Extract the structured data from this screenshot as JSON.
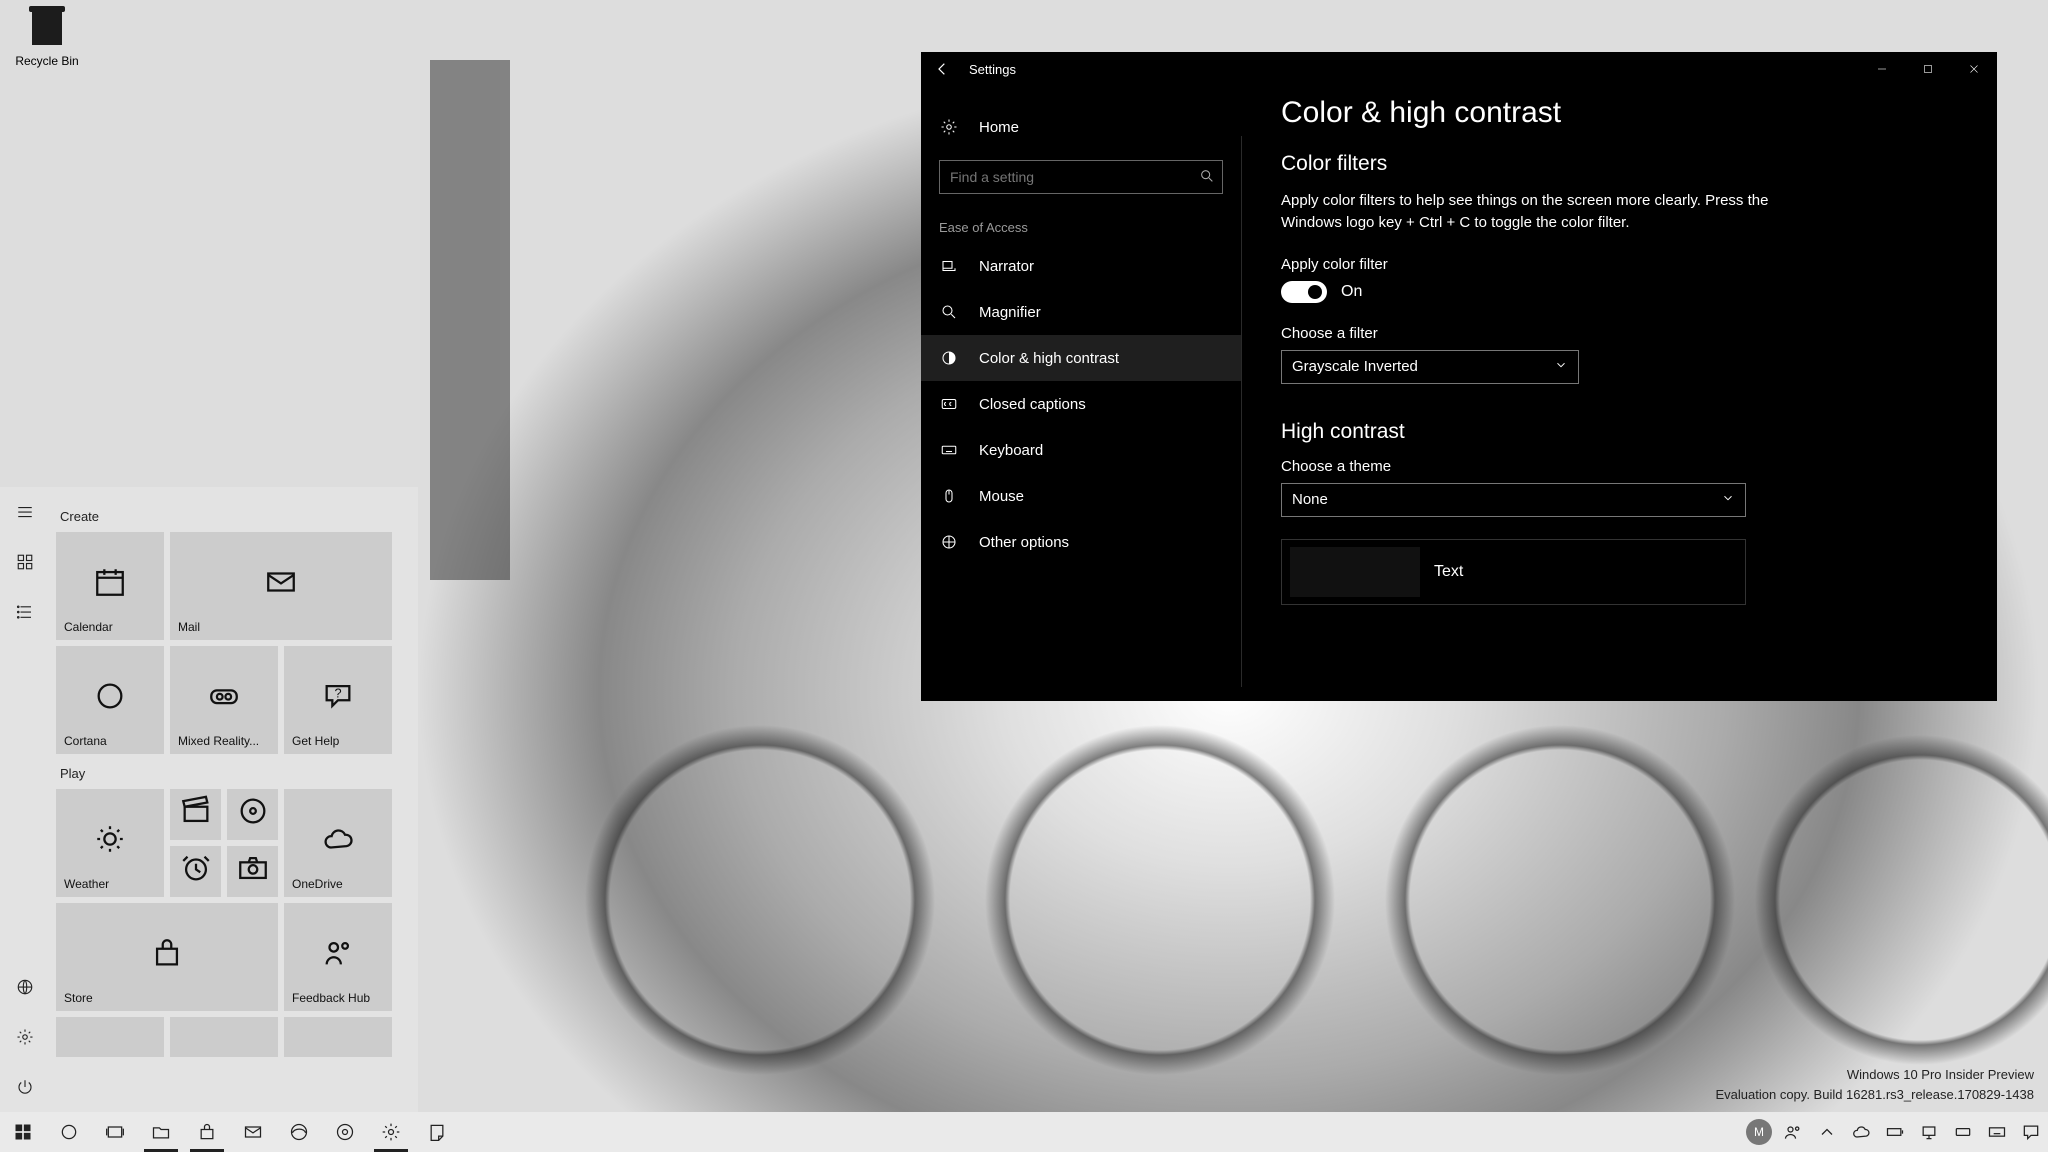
{
  "desktop": {
    "recycle_bin_label": "Recycle Bin"
  },
  "watermark": {
    "line1": "Windows 10 Pro Insider Preview",
    "line2": "Evaluation copy. Build 16281.rs3_release.170829-1438"
  },
  "start": {
    "groups": [
      {
        "label": "Create"
      },
      {
        "label": "Play"
      }
    ],
    "tiles": {
      "calendar": "Calendar",
      "mail": "Mail",
      "cortana": "Cortana",
      "mixed_reality": "Mixed Reality...",
      "get_help": "Get Help",
      "weather": "Weather",
      "onedrive": "OneDrive",
      "store": "Store",
      "feedback": "Feedback Hub"
    },
    "user_initial": "M"
  },
  "taskbar": {
    "apps": [
      "start",
      "search",
      "task-view",
      "file-explorer",
      "store",
      "mail",
      "edge",
      "photos",
      "settings",
      "sticky-notes"
    ]
  },
  "settings": {
    "title": "Settings",
    "search_placeholder": "Find a setting",
    "home": "Home",
    "category": "Ease of Access",
    "nav": [
      {
        "key": "narrator",
        "label": "Narrator"
      },
      {
        "key": "magnifier",
        "label": "Magnifier"
      },
      {
        "key": "color",
        "label": "Color & high contrast",
        "selected": true
      },
      {
        "key": "captions",
        "label": "Closed captions"
      },
      {
        "key": "keyboard",
        "label": "Keyboard"
      },
      {
        "key": "mouse",
        "label": "Mouse"
      },
      {
        "key": "other",
        "label": "Other options"
      }
    ],
    "page": {
      "title": "Color & high contrast",
      "section_filters": "Color filters",
      "filters_descr": "Apply color filters to help see things on the screen more clearly. Press the Windows logo key + Ctrl + C to toggle the color filter.",
      "apply_label": "Apply color filter",
      "toggle_state": "On",
      "choose_filter_label": "Choose a filter",
      "filter_value": "Grayscale Inverted",
      "section_hc": "High contrast",
      "choose_theme_label": "Choose a theme",
      "theme_value": "None",
      "preview_text": "Text"
    }
  }
}
